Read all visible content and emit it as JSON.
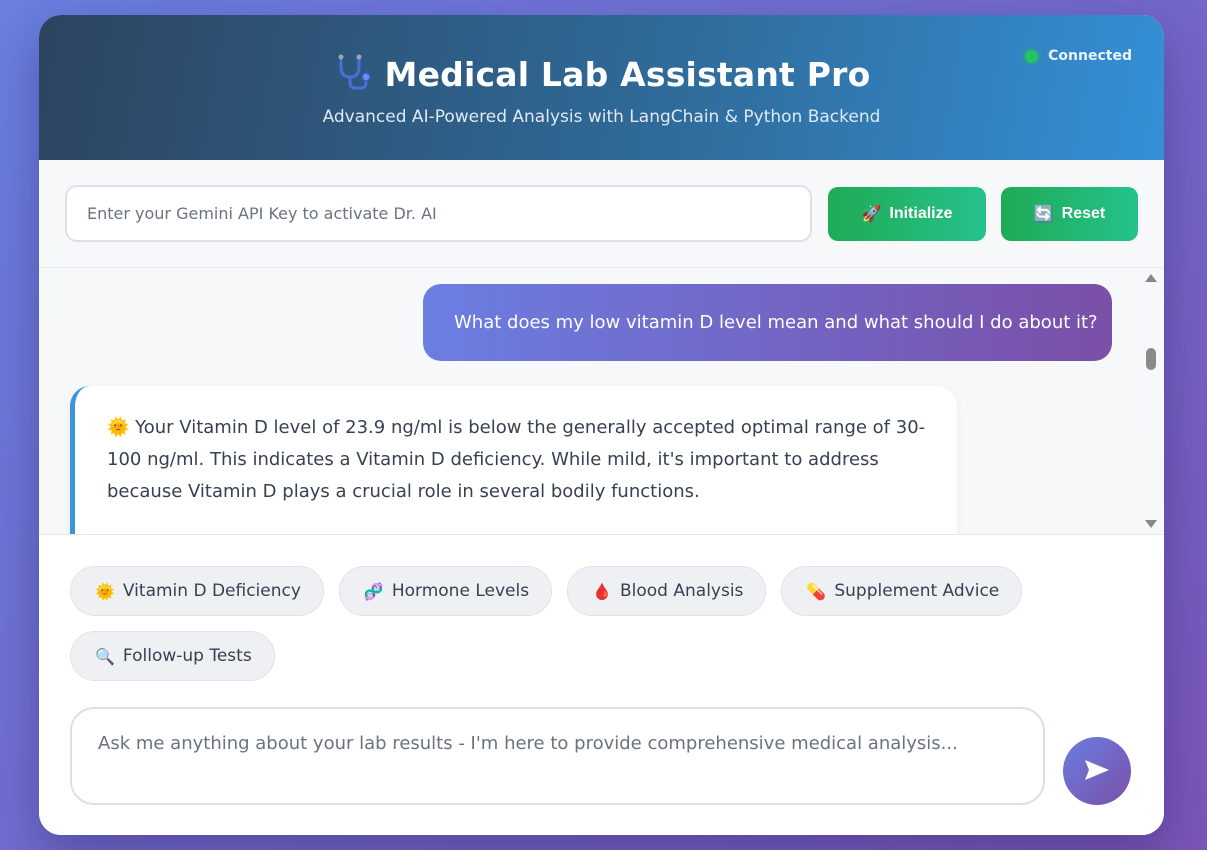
{
  "header": {
    "title": "Medical Lab Assistant Pro",
    "subtitle": "Advanced AI-Powered Analysis with LangChain & Python Backend",
    "status": "Connected",
    "title_icon": "stethoscope-icon"
  },
  "api": {
    "placeholder": "Enter your Gemini API Key to activate Dr. AI",
    "initialize_label": "Initialize",
    "initialize_icon": "🚀",
    "reset_label": "Reset",
    "reset_icon": "🔄"
  },
  "chat": {
    "user_message": "What does my low vitamin D level mean and what should I do about it?",
    "bot_icon": "🌞",
    "bot_message": "Your Vitamin D level of 23.9 ng/ml is below the generally accepted optimal range of 30-100 ng/ml. This indicates a Vitamin D deficiency. While mild, it's important to address because Vitamin D plays a crucial role in several bodily functions."
  },
  "quick_actions": [
    {
      "icon": "🌞",
      "label": "Vitamin D Deficiency"
    },
    {
      "icon": "🧬",
      "label": "Hormone Levels"
    },
    {
      "icon": "🩸",
      "label": "Blood Analysis"
    },
    {
      "icon": "💊",
      "label": "Supplement Advice"
    },
    {
      "icon": "🔍",
      "label": "Follow-up Tests"
    }
  ],
  "composer": {
    "placeholder": "Ask me anything about your lab results - I'm here to provide comprehensive medical analysis..."
  },
  "colors": {
    "accent": "#6b7ee2",
    "green": "#22c55e",
    "header_dark": "#2d4460",
    "header_light": "#3590d6"
  }
}
